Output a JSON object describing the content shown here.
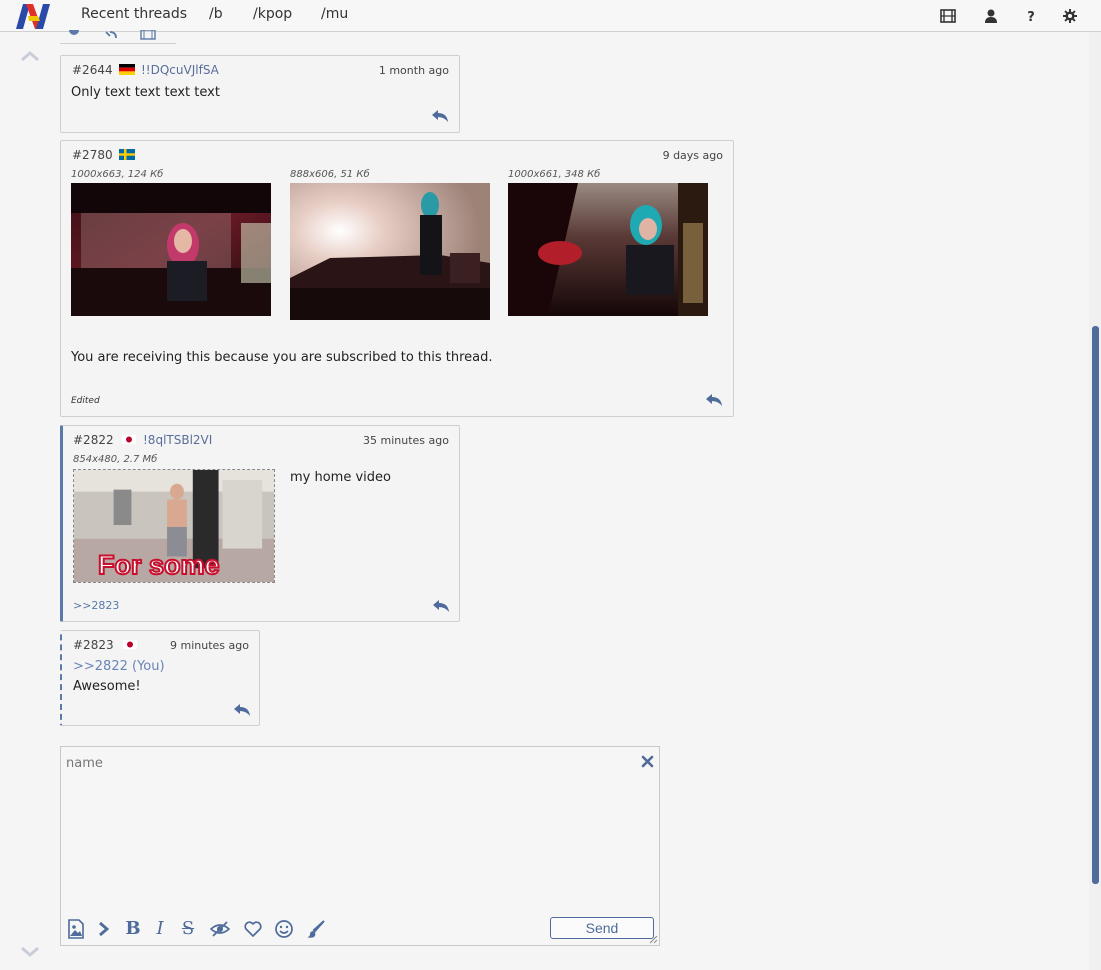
{
  "header": {
    "nav": [
      "Recent threads",
      "/b",
      "/kpop",
      "/mu"
    ]
  },
  "posts": [
    {
      "num": "#2644",
      "name": "!!DQcuVJlfSA",
      "time": "1 month ago",
      "body": "Only text text text text"
    },
    {
      "num": "#2780",
      "time": "9 days ago",
      "files": [
        "1000x663, 124 Кб",
        "888x606, 51 Кб",
        "1000x661, 348 Кб"
      ],
      "body": "You are receiving this because you are subscribed to this thread.",
      "edited": "Edited"
    },
    {
      "num": "#2822",
      "name": "!8qlTSBl2VI",
      "time": "35 minutes ago",
      "file": "854x480, 2.7 Мб",
      "thumb_caption": "For some",
      "body": "my home video",
      "backlink": ">>2823"
    },
    {
      "num": "#2823",
      "time": "9 minutes ago",
      "quote": ">>2822 (You)",
      "body": "Awesome!"
    }
  ],
  "form": {
    "name_placeholder": "name",
    "send_label": "Send"
  },
  "colors": {
    "accent": "#4e6b9b",
    "link": "#5a7aa8"
  },
  "icons": [
    "logo",
    "video-icon",
    "user-icon",
    "help-icon",
    "gear-icon",
    "reply-icon",
    "image-upload-icon",
    "spoiler-icon",
    "heart-icon",
    "smiley-icon",
    "brush-icon"
  ]
}
